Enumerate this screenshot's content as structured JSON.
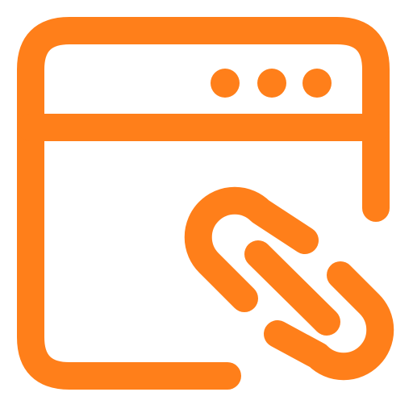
{
  "icon": {
    "name": "browser-window-link-icon",
    "color": "#FF7F1A",
    "background": "#FFFFFF",
    "window": {
      "dots_count": 3
    }
  }
}
